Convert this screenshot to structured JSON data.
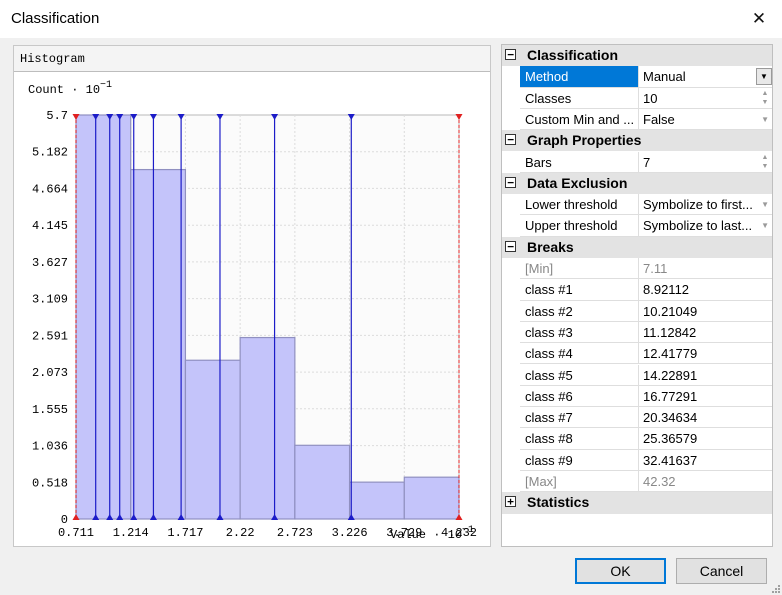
{
  "window": {
    "title": "Classification"
  },
  "histogram": {
    "panel_title": "Histogram",
    "count_label": "Count",
    "value_label": "Value",
    "scale_mark": "·",
    "scale_base": "10",
    "scale_exp": "−1"
  },
  "chart_data": {
    "type": "bar",
    "xlabel": "Value · 10^-1",
    "ylabel": "Count · 10^-1",
    "xlim": [
      0.711,
      4.232
    ],
    "ylim": [
      0,
      5.7
    ],
    "x_ticks": [
      "0.711",
      "1.214",
      "1.717",
      "2.22",
      "2.723",
      "3.226",
      "3.729",
      "4.232"
    ],
    "y_ticks": [
      "0",
      "0.518",
      "1.036",
      "1.555",
      "2.073",
      "2.591",
      "3.109",
      "3.627",
      "4.145",
      "4.664",
      "5.182",
      "5.7"
    ],
    "bin_edges": [
      0.711,
      1.214,
      1.717,
      2.22,
      2.723,
      3.226,
      3.729,
      4.232
    ],
    "values": [
      5.7,
      4.93,
      2.24,
      2.56,
      1.04,
      0.52,
      0.59
    ],
    "break_values": [
      0.892112,
      1.021049,
      1.112842,
      1.241779,
      1.422891,
      1.677291,
      2.034634,
      2.536579,
      3.241637
    ],
    "min": 0.711,
    "max": 4.232,
    "grid": true,
    "colors": {
      "bar_fill": "#c4c4fa",
      "bar_edge": "#9090c0",
      "break_line": "#1c1cc8",
      "min_max_line": "#e02020"
    }
  },
  "properties": {
    "classification": {
      "header": "Classification",
      "method": {
        "label": "Method",
        "value": "Manual"
      },
      "classes": {
        "label": "Classes",
        "value": "10"
      },
      "custom": {
        "label": "Custom Min and ...",
        "value": "False"
      }
    },
    "graph": {
      "header": "Graph Properties",
      "bars": {
        "label": "Bars",
        "value": "7"
      }
    },
    "exclusion": {
      "header": "Data Exclusion",
      "lower": {
        "label": "Lower threshold",
        "value": "Symbolize to first..."
      },
      "upper": {
        "label": "Upper threshold",
        "value": "Symbolize to last..."
      }
    },
    "breaks": {
      "header": "Breaks",
      "min": {
        "label": "[Min]",
        "value": "7.11"
      },
      "classes": [
        {
          "label": "class #1",
          "value": "8.92112"
        },
        {
          "label": "class #2",
          "value": "10.21049"
        },
        {
          "label": "class #3",
          "value": "11.12842"
        },
        {
          "label": "class #4",
          "value": "12.41779"
        },
        {
          "label": "class #5",
          "value": "14.22891"
        },
        {
          "label": "class #6",
          "value": "16.77291"
        },
        {
          "label": "class #7",
          "value": "20.34634"
        },
        {
          "label": "class #8",
          "value": "25.36579"
        },
        {
          "label": "class #9",
          "value": "32.41637"
        }
      ],
      "max": {
        "label": "[Max]",
        "value": "42.32"
      }
    },
    "statistics": {
      "header": "Statistics"
    }
  },
  "buttons": {
    "ok": "OK",
    "cancel": "Cancel"
  },
  "icons": {
    "close": "close-icon",
    "collapse": "minus-box-icon",
    "expand": "plus-box-icon",
    "dropdown": "chevron-down-icon",
    "spin": "spin-arrows-icon",
    "grip": "resize-grip-icon"
  },
  "glyphs": {
    "minus": "−",
    "plus": "+",
    "down": "▼",
    "up": "▲",
    "close": "✕"
  }
}
